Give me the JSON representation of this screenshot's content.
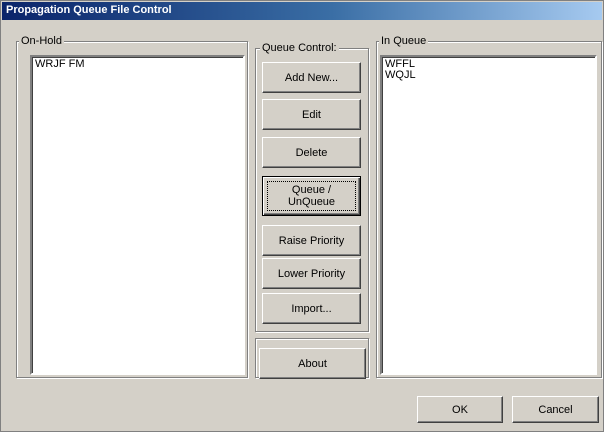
{
  "window": {
    "title": "Propagation Queue File Control"
  },
  "on_hold": {
    "label": "On-Hold",
    "items": [
      "WRJF FM"
    ]
  },
  "queue_control": {
    "label": "Queue Control:",
    "buttons": {
      "add_new": "Add New...",
      "edit": "Edit",
      "delete": "Delete",
      "queue_unqueue": "Queue /\nUnQueue",
      "raise_priority": "Raise Priority",
      "lower_priority": "Lower Priority",
      "import": "Import...",
      "about": "About"
    }
  },
  "in_queue": {
    "label": "In Queue",
    "items": [
      "WFFL",
      "WQJL"
    ]
  },
  "footer": {
    "ok": "OK",
    "cancel": "Cancel"
  }
}
